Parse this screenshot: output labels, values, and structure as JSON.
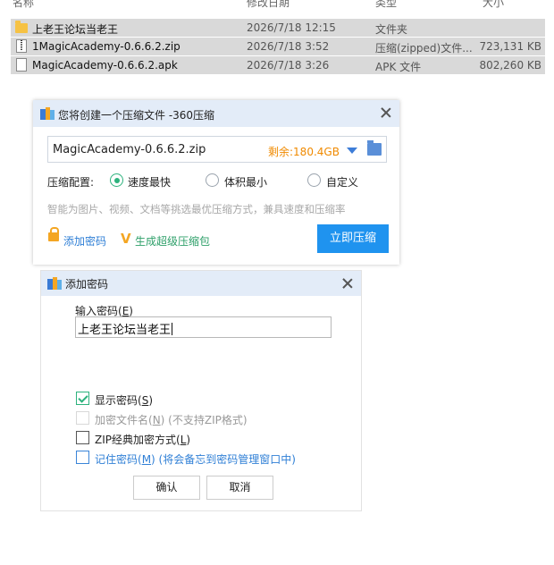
{
  "file_list": {
    "columns": {
      "name": "名称",
      "date": "修改日期",
      "type": "类型",
      "size": "大小"
    },
    "rows": [
      {
        "icon": "folder-icon",
        "name": "上老王论坛当老王",
        "date": "2026/7/18 12:15",
        "type": "文件夹",
        "size": ""
      },
      {
        "icon": "zip-icon",
        "name": "1MagicAcademy-0.6.6.2.zip",
        "date": "2026/7/18 3:52",
        "type": "压缩(zipped)文件...",
        "size": "723,131 KB"
      },
      {
        "icon": "apk-icon",
        "name": "MagicAcademy-0.6.6.2.apk",
        "date": "2026/7/18 3:26",
        "type": "APK 文件",
        "size": "802,260 KB"
      }
    ]
  },
  "compress_dialog": {
    "title": "您将创建一个压缩文件 -360压缩",
    "path_value": "MagicAcademy-0.6.6.2.zip",
    "free_space": "剩余:180.4GB",
    "config_label": "压缩配置:",
    "options": [
      {
        "label": "速度最快",
        "checked": true
      },
      {
        "label": "体积最小",
        "checked": false
      },
      {
        "label": "自定义",
        "checked": false
      }
    ],
    "hint": "智能为图片、视频、文档等挑选最优压缩方式，兼具速度和压缩率",
    "add_password": "添加密码",
    "super_pack": "生成超级压缩包",
    "compress_now": "立即压缩",
    "accent_color": "#1f93ef"
  },
  "password_dialog": {
    "title": "添加密码",
    "input_label": "输入密码(",
    "input_label_key": "E",
    "input_label_end": ")",
    "password_value": "上老王论坛当老王",
    "show_password": {
      "text": "显示密码(",
      "key": "S",
      "end": ")",
      "checked": true
    },
    "encrypt_names": {
      "text": "加密文件名(",
      "key": "N",
      "end": ") (不支持ZIP格式)",
      "checked": false,
      "disabled": true
    },
    "zip_classic": {
      "text": "ZIP经典加密方式(",
      "key": "L",
      "end": ")",
      "checked": false
    },
    "remember": {
      "text": "记住密码(",
      "key": "M",
      "end": ") (将会备忘到密码管理窗口中)",
      "checked": false
    },
    "ok": "确认",
    "cancel": "取消"
  }
}
